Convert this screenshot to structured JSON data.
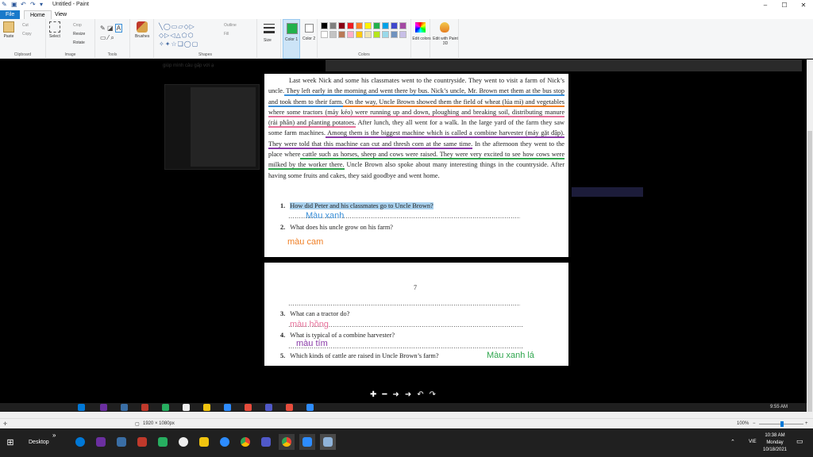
{
  "window": {
    "title": "Untitled - Paint"
  },
  "tabs": [
    {
      "label": "File"
    },
    {
      "label": "Home"
    },
    {
      "label": "View"
    }
  ],
  "ribbon": {
    "clipboard": {
      "label": "Clipboard",
      "paste": "Paste",
      "cut": "Cut",
      "copy": "Copy"
    },
    "image": {
      "label": "Image",
      "select": "Select",
      "crop": "Crop",
      "resize": "Resize",
      "rotate": "Rotate"
    },
    "tools": {
      "label": "Tools"
    },
    "brushes": {
      "label": "Brushes"
    },
    "shapes": {
      "label": "Shapes",
      "outline": "Outline",
      "fill": "Fill"
    },
    "size": {
      "label": "Size"
    },
    "color1": {
      "label": "Color 1"
    },
    "color2": {
      "label": "Color 2"
    },
    "colors": {
      "label": "Colors",
      "edit_colors": "Edit colors",
      "edit_paint3d": "Edit with Paint 3D"
    },
    "palette": [
      "#000000",
      "#7f7f7f",
      "#880015",
      "#ed1c24",
      "#ff7f27",
      "#fff200",
      "#22b14c",
      "#00a2e8",
      "#3f48cc",
      "#a349a4",
      "#ffffff",
      "#c3c3c3",
      "#b97a57",
      "#ffaec9",
      "#ffc90e",
      "#efe4b0",
      "#b5e61d",
      "#99d9ea",
      "#7092be",
      "#c8bfe7"
    ],
    "color1_value": "#22b14c"
  },
  "background_text": "giúp mình câu gấp với ạ",
  "document": {
    "paragraph": {
      "s1": "Last week Nick and some his classmates went to the countryside. They went to visit a farm of Nick’s uncle.",
      "s2": " They left early in the morning and went there by bus. Nick’s uncle, Mr. Brown met them at the bus stop and took them to their farm.",
      "s3": " On the way, Uncle Brown showed them the field of wheat (lúa mì) and vegetables",
      "s4": " where some tractors (máy kéo) were running up and down, ploughing and breaking soil, distributing manure (rải phân) and planting potatoes.",
      "s5": " After lunch, they all went for a walk. In the large yard of the farm they saw some farm machines.",
      "s6": " Among them is the biggest machine which is called a combine harvester (máy gặt đập). They were told that this machine can cut and thresh corn at the same time.",
      "s7": " In the afternoon they went to the place where",
      "s8": " cattle such as horses, sheep and cows were raised. They were very excited to see how cows were milked by the worker there.",
      "s9": " Uncle Brown also spoke about many interesting things in the countryside. After having some fruits and cakes, they said goodbye and went home."
    },
    "questions": [
      {
        "num": "1.",
        "text": "How did Peter and his classmates go to Uncle Brown?"
      },
      {
        "num": "2.",
        "text": "What does his uncle grow on his farm?"
      },
      {
        "num": "3.",
        "text": "What can a tractor do?"
      },
      {
        "num": "4.",
        "text": "What is typical of a combine harvester?"
      },
      {
        "num": "5.",
        "text": "Which kinds of cattle are raised in Uncle Brown’s farm?"
      }
    ],
    "page_number": "7",
    "dots": "…………………………………………………………………………………………………"
  },
  "annotations": [
    {
      "text": "Màu xanh",
      "color": "#3a8fd8"
    },
    {
      "text": "màu cam",
      "color": "#f07f25"
    },
    {
      "text": "màu hồng",
      "color": "#e8739c"
    },
    {
      "text": "màu tím",
      "color": "#8a3ca8"
    },
    {
      "text": "Màu xanh lá",
      "color": "#2fa64e"
    }
  ],
  "inner_clock": {
    "time": "9:55 AM"
  },
  "status": {
    "dimensions": "1920 × 1080px",
    "zoom": "100%"
  },
  "taskbar": {
    "desktop": "Desktop",
    "lang": "VIE",
    "time": "10:38 AM",
    "day": "Monday",
    "date": "10/18/2021"
  }
}
